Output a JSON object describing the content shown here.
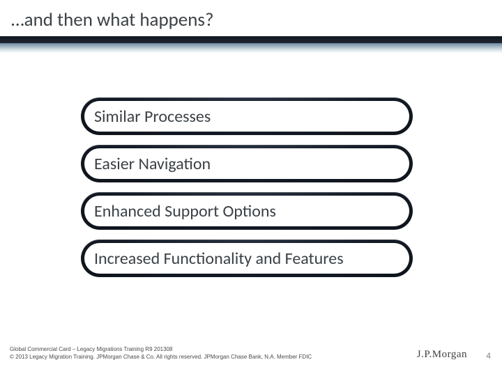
{
  "title": "…and then what happens?",
  "bars": {
    "b0": "Similar Processes",
    "b1": "Easier Navigation",
    "b2": "Enhanced Support Options",
    "b3": "Increased Functionality and Features"
  },
  "footer": {
    "line1": "Global Commercial Card – Legacy Migrations Training R9 201308",
    "line2": "© 2013  Legacy Migration Training. JPMorgan Chase & Co. All rights reserved. JPMorgan Chase Bank, N.A. Member FDIC"
  },
  "logo": {
    "jp": "J.P.",
    "morgan": "Morgan"
  },
  "page_number": "4"
}
